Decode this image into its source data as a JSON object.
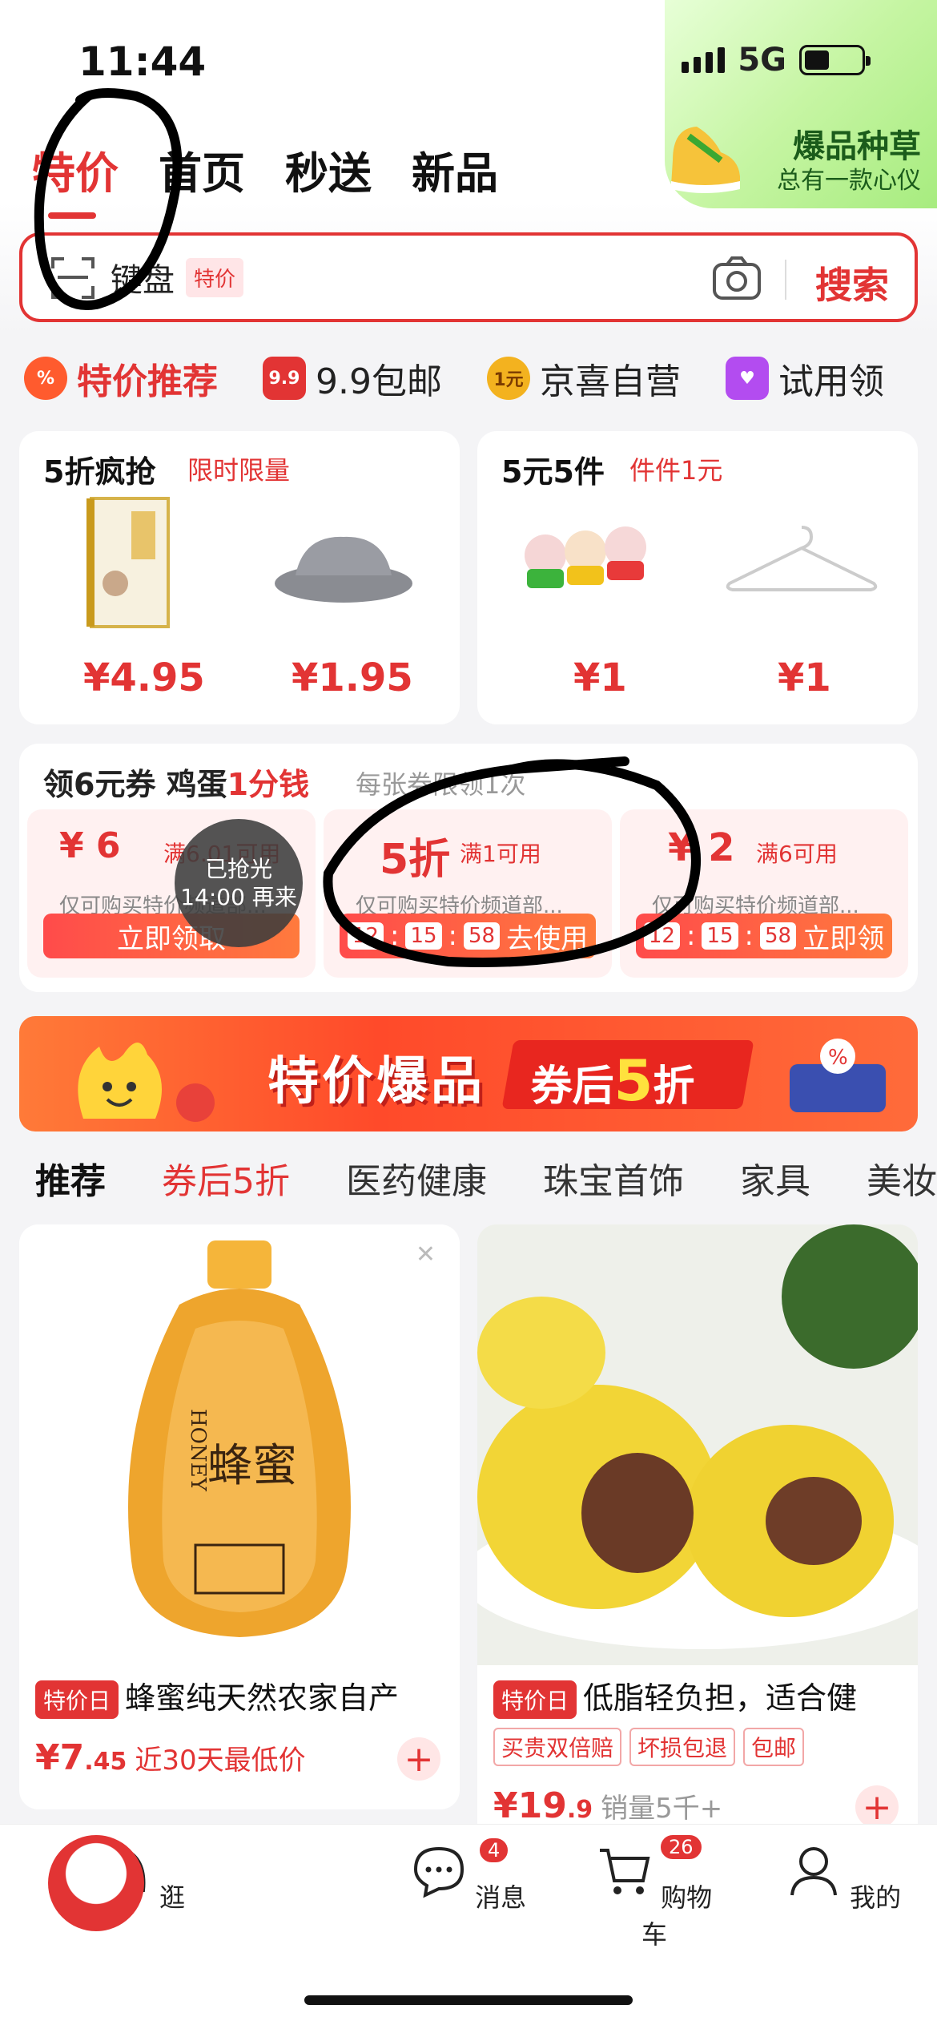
{
  "status_bar": {
    "time": "11:44",
    "network": "5G"
  },
  "header": {
    "tabs": [
      {
        "label": "特价"
      },
      {
        "label": "首页"
      },
      {
        "label": "秒送"
      },
      {
        "label": "新品"
      }
    ],
    "promo": {
      "title": "爆品种草",
      "subtitle": "总有一款心仪"
    }
  },
  "search": {
    "query": "键盘",
    "tag": "特价",
    "button": "搜索"
  },
  "quick_links": [
    {
      "label": "特价推荐",
      "icon": "%"
    },
    {
      "label": "9.9包邮",
      "icon": "9.9"
    },
    {
      "label": "京喜自营",
      "icon": "1元"
    },
    {
      "label": "试用领",
      "icon": "♥"
    }
  ],
  "deals": [
    {
      "title": "5折疯抢",
      "subtitle": "限时限量",
      "prices": [
        "¥4.95",
        "¥1.95"
      ]
    },
    {
      "title": "5元5件",
      "subtitle": "件件1元",
      "prices": [
        "¥1",
        "¥1"
      ]
    }
  ],
  "coupons": {
    "title_prefix": "领6元券 鸡蛋",
    "title_highlight": "1分钱",
    "note": "每张券限领1次",
    "items": [
      {
        "value": "¥ 6",
        "condition": "满6.01可用",
        "desc": "仅可购买特价频道部...",
        "button": "立即领取",
        "sold_out_1": "已抢光",
        "sold_out_2": "14:00 再来"
      },
      {
        "value": "5折",
        "condition": "满1可用",
        "desc": "仅可购买特价频道部...",
        "timer": [
          "12",
          "15",
          "58"
        ],
        "button": "去使用"
      },
      {
        "value": "¥ 2",
        "condition": "满6可用",
        "desc": "仅可购买特价频道部...",
        "timer": [
          "12",
          "15",
          "58"
        ],
        "button": "立即领"
      }
    ]
  },
  "banner": {
    "title": "特价爆品",
    "badge_prefix": "券后",
    "badge_num": "5",
    "badge_suffix": "折"
  },
  "category_tabs": [
    "推荐",
    "券后5折",
    "医药健康",
    "珠宝首饰",
    "家具",
    "美妆护"
  ],
  "products": [
    {
      "tag": "特价日",
      "name": "蜂蜜纯天然农家自产",
      "price_int": "¥7",
      "price_dec": ".45",
      "note": "近30天最低价",
      "image_text": "蜂蜜",
      "image_label": "HONEY"
    },
    {
      "tag": "特价日",
      "name": "低脂轻负担，适合健",
      "labels": [
        "买贵双倍赔",
        "坏损包退",
        "包邮"
      ],
      "price_int": "¥19",
      "price_dec": ".9",
      "note": "销量5千+"
    }
  ],
  "bottom_nav": [
    {
      "label": ""
    },
    {
      "label": "逛"
    },
    {
      "label": "消息",
      "badge": "4"
    },
    {
      "label": "购物车",
      "badge": "26"
    },
    {
      "label": "我的"
    }
  ],
  "colors": {
    "accent": "#e23434",
    "promo_green": "#a7ec7f"
  }
}
